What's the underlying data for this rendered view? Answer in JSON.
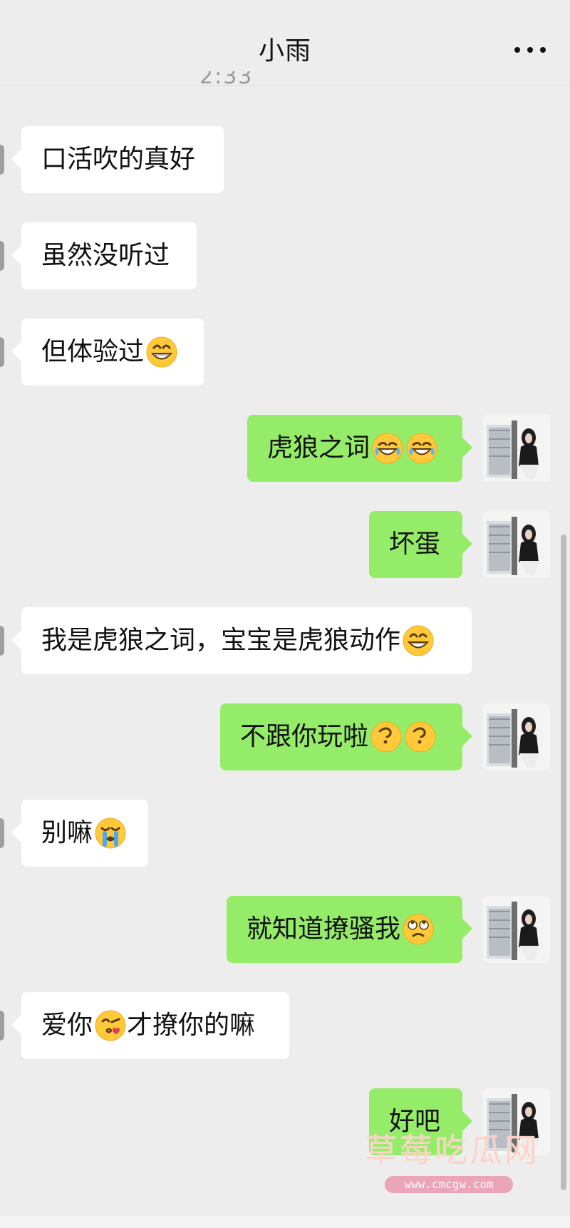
{
  "header": {
    "title": "小雨",
    "more_icon": "more-icon"
  },
  "timestamp_partial": "2:33",
  "messages": [
    {
      "side": "left",
      "text": "口活吹的真好"
    },
    {
      "side": "left",
      "text": "虽然没听过"
    },
    {
      "side": "left",
      "text": "但体验过",
      "emojis": [
        "grinning-face-icon"
      ]
    },
    {
      "side": "right",
      "text": "虎狼之词",
      "emojis": [
        "laughing-tears-icon",
        "laughing-tears-icon"
      ]
    },
    {
      "side": "right",
      "text": "坏蛋"
    },
    {
      "side": "left",
      "text": "我是虎狼之词，宝宝是虎狼动作",
      "emojis": [
        "grinning-face-icon"
      ]
    },
    {
      "side": "right",
      "text": "不跟你玩啦",
      "emojis": [
        "confused-face-icon",
        "confused-face-icon"
      ]
    },
    {
      "side": "left",
      "text": "别嘛",
      "emojis": [
        "crying-face-icon"
      ]
    },
    {
      "side": "right",
      "text": "就知道撩骚我",
      "emojis": [
        "eye-roll-icon"
      ]
    },
    {
      "side": "left",
      "text_before": "爱你",
      "emoji": "kiss-face-icon",
      "text_after": "才撩你的嘛"
    },
    {
      "side": "right",
      "text": "好吧"
    }
  ],
  "watermark": {
    "text": "草莓吃瓜网",
    "url": "www.cmcgw.com"
  },
  "colors": {
    "background": "#ededed",
    "incoming_bubble": "#ffffff",
    "outgoing_bubble": "#95ec69"
  }
}
